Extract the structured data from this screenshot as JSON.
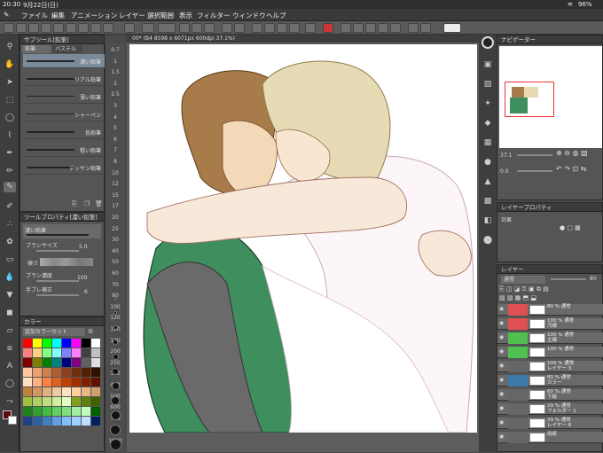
{
  "status": {
    "time": "20:30",
    "date": "9月22日(日)",
    "battery": "96%"
  },
  "menu": [
    "ファイル",
    "編集",
    "アニメーション",
    "レイヤー",
    "選択範囲",
    "表示",
    "フィルター",
    "ウィンドウ",
    "ヘルプ"
  ],
  "canvas_tab": "00* (B4 8598 x 6071px 600dpi 37.1%)",
  "subtool": {
    "title": "サブツール[鉛筆]",
    "tabs": [
      "鉛筆",
      "パステル"
    ],
    "brushes": [
      "濃い鉛筆",
      "リアル鉛筆",
      "薄い鉛筆",
      "シャーペン",
      "色鉛筆",
      "粗い鉛筆",
      "デッサン鉛筆"
    ]
  },
  "toolprop": {
    "title": "ツールプロパティ[濃い鉛筆]",
    "current": "濃い鉛筆",
    "rows": [
      {
        "label": "ブラシサイズ",
        "value": "5.0"
      },
      {
        "label": "硬さ",
        "value": ""
      },
      {
        "label": "ブラシ濃度",
        "value": "100"
      },
      {
        "label": "手ブレ補正",
        "value": "6"
      }
    ]
  },
  "color": {
    "title": "カラー",
    "set_name": "追加カラーセット"
  },
  "ruler": [
    "0.7",
    "1",
    "1.5",
    "2",
    "2.5",
    "3",
    "4",
    "5",
    "6",
    "7",
    "8",
    "10",
    "12",
    "15",
    "17",
    "20",
    "25",
    "30",
    "40",
    "50",
    "60",
    "70",
    "80",
    "100",
    "120",
    "150",
    "170",
    "200",
    "250",
    "300",
    "400",
    "500",
    "600",
    "700",
    "800",
    "1000"
  ],
  "navigator": {
    "title": "ナビゲーター",
    "zoom": "37.1",
    "angle": "0.0"
  },
  "layerprop": {
    "title": "レイヤープロパティ",
    "effect_label": "効果"
  },
  "layers": {
    "title": "レイヤー",
    "blend": "通常",
    "opacity": "80",
    "rows": [
      {
        "text": "80 % 通常\n",
        "color": "#e05050"
      },
      {
        "text": "100 % 通常\n汚線",
        "color": "#e05050"
      },
      {
        "text": "100 % 通常\n主線",
        "color": "#50c050"
      },
      {
        "text": "100 % 通常\n",
        "color": "#50c050"
      },
      {
        "text": "100 % 通常\nレイヤー 3",
        "color": "#666666"
      },
      {
        "text": "80 % 通常\nカラー",
        "color": "#3c79a8"
      },
      {
        "text": "60 % 通常\n下絵",
        "color": "#666666"
      },
      {
        "text": "29 % 通常\nフォルダー 1",
        "color": "#666666"
      },
      {
        "text": "39 % 通常\nレイヤー 8",
        "color": "#666666"
      },
      {
        "text": "用紙",
        "color": "#666666"
      }
    ]
  },
  "palette_colors": [
    "#ff0000",
    "#ffff00",
    "#00ff00",
    "#00ffff",
    "#0000ff",
    "#ff00ff",
    "#000000",
    "#ffffff",
    "#ff8080",
    "#ffd080",
    "#80ff80",
    "#80ffff",
    "#8080ff",
    "#ff80ff",
    "#404040",
    "#c0c0c0",
    "#800000",
    "#808000",
    "#008000",
    "#008080",
    "#000080",
    "#800080",
    "#606060",
    "#e0e0e0",
    "#ffc8a0",
    "#f0a070",
    "#d08050",
    "#b06030",
    "#904020",
    "#703010",
    "#502000",
    "#301000",
    "#ffe0c0",
    "#ffb080",
    "#ff8040",
    "#e06020",
    "#c04000",
    "#a03000",
    "#802000",
    "#601000",
    "#c08040",
    "#d09860",
    "#e0b080",
    "#f0c8a0",
    "#f8e0c0",
    "#ffd0a0",
    "#e8b888",
    "#d0a070",
    "#a0c040",
    "#b0d060",
    "#c0e080",
    "#d0f0a0",
    "#e0ffc0",
    "#80a020",
    "#608010",
    "#406000",
    "#208020",
    "#30a030",
    "#40c040",
    "#60d060",
    "#80e080",
    "#a0f0a0",
    "#c0ffc0",
    "#006000",
    "#204080",
    "#3060a0",
    "#4080c0",
    "#60a0e0",
    "#80c0ff",
    "#a0d0ff",
    "#c0e0ff",
    "#002060"
  ]
}
